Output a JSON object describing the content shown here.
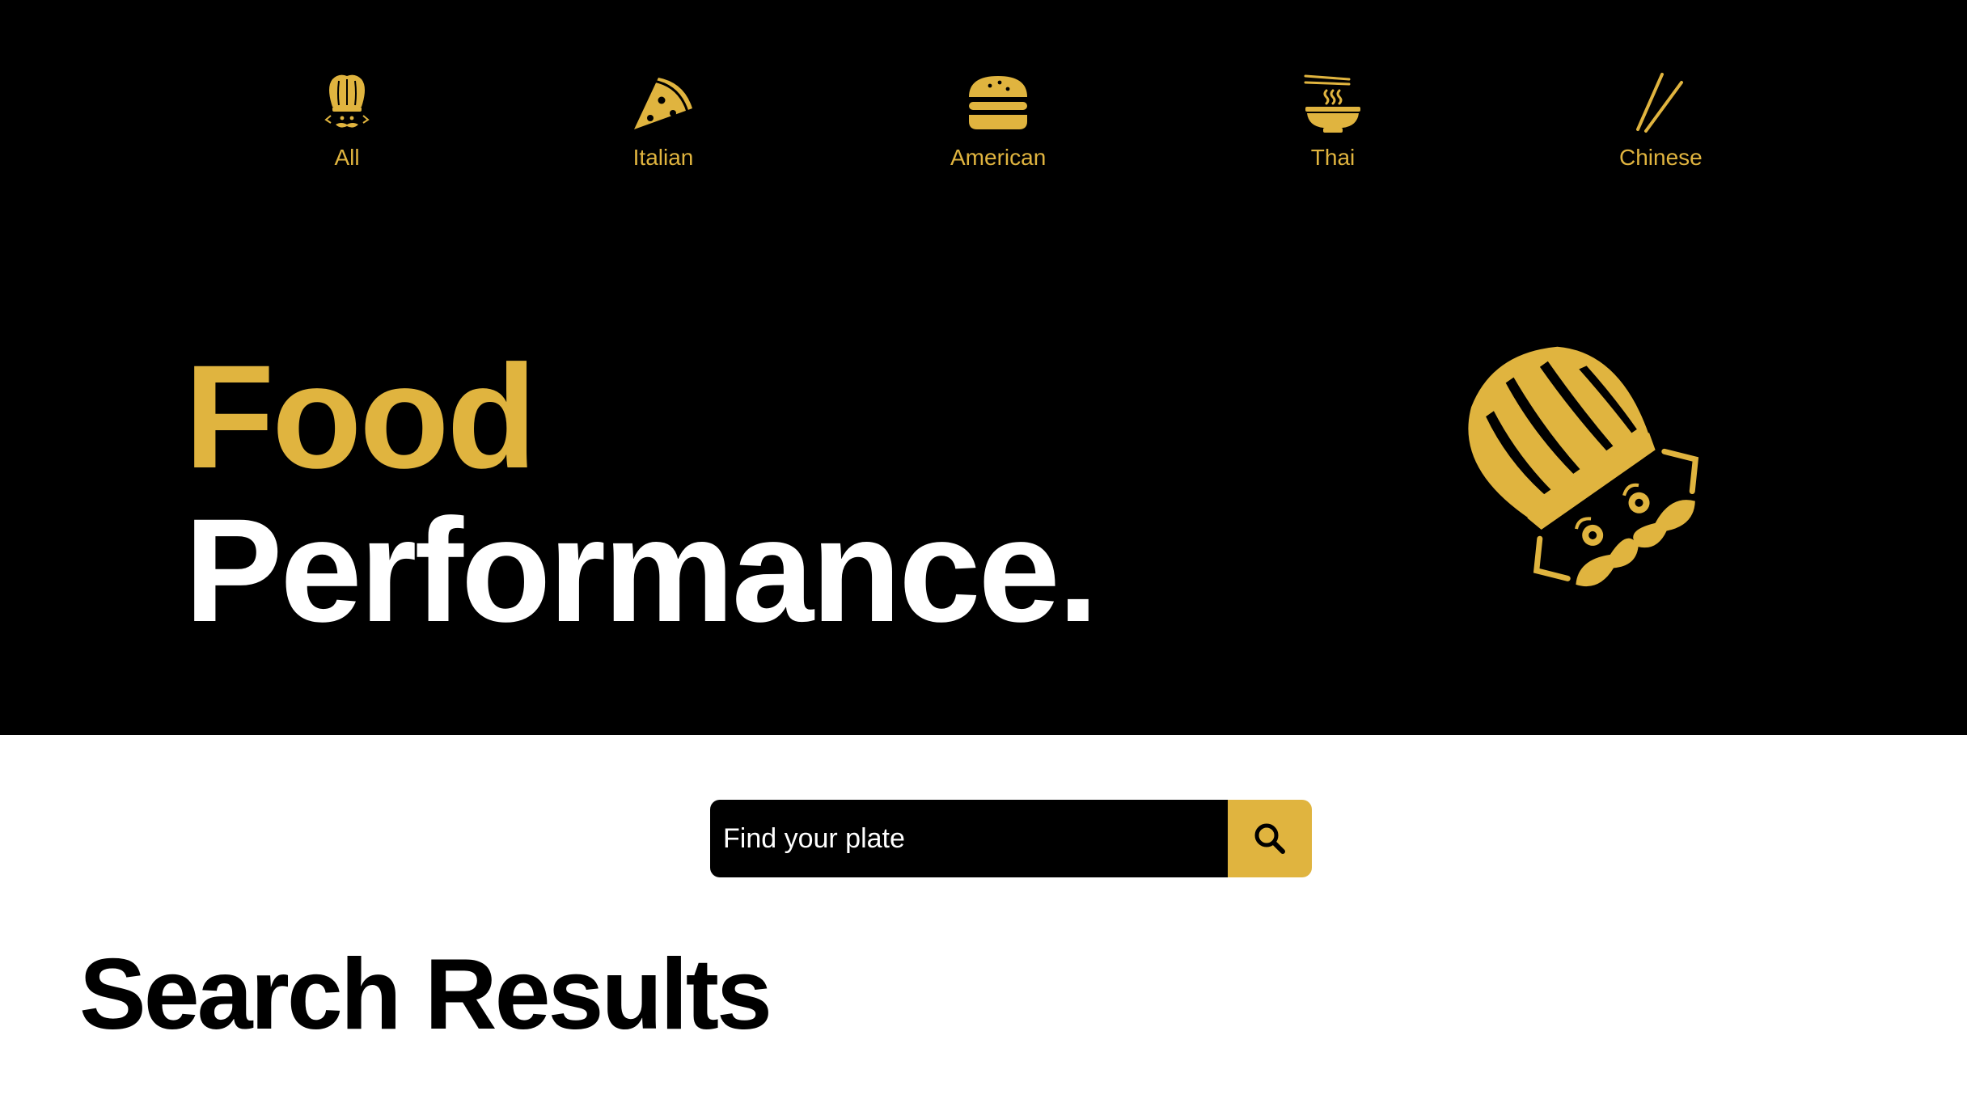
{
  "nav": {
    "items": [
      {
        "label": "All",
        "icon": "chef-hat-icon"
      },
      {
        "label": "Italian",
        "icon": "pizza-slice-icon"
      },
      {
        "label": "American",
        "icon": "burger-icon"
      },
      {
        "label": "Thai",
        "icon": "noodle-bowl-icon"
      },
      {
        "label": "Chinese",
        "icon": "chopsticks-icon"
      }
    ]
  },
  "hero": {
    "line1": "Food",
    "line2": "Performance.",
    "mascot": "chef-mascot-icon"
  },
  "search": {
    "placeholder": "Find your plate",
    "button_icon": "search-icon"
  },
  "results": {
    "title": "Search Results"
  },
  "colors": {
    "accent": "#e0b43f",
    "hero_background": "#000000",
    "page_background": "#ffffff"
  }
}
